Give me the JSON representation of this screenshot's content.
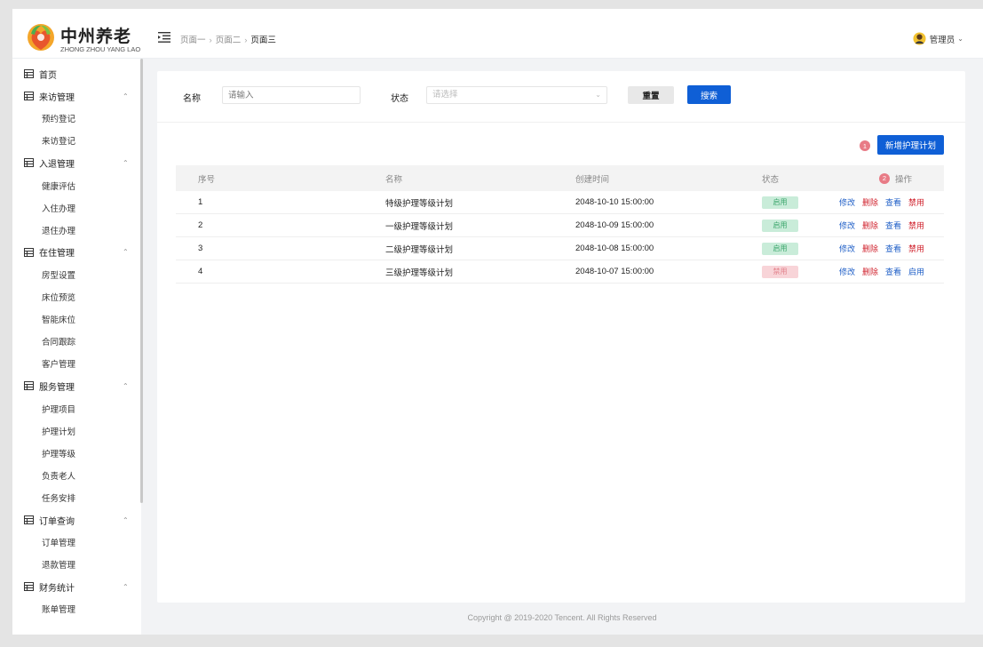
{
  "header": {
    "logo_title": "中州养老",
    "logo_subtitle": "ZHONG ZHOU YANG LAO",
    "breadcrumb": [
      "页面一",
      "页面二",
      "页面三"
    ],
    "user_name": "管理员"
  },
  "sidebar": {
    "items": [
      {
        "label": "首页",
        "type": "group",
        "expandable": false
      },
      {
        "label": "来访管理",
        "type": "group",
        "expandable": true
      },
      {
        "label": "预约登记",
        "type": "child"
      },
      {
        "label": "来访登记",
        "type": "child"
      },
      {
        "label": "入退管理",
        "type": "group",
        "expandable": true
      },
      {
        "label": "健康评估",
        "type": "child"
      },
      {
        "label": "入住办理",
        "type": "child"
      },
      {
        "label": "退住办理",
        "type": "child"
      },
      {
        "label": "在住管理",
        "type": "group",
        "expandable": true
      },
      {
        "label": "房型设置",
        "type": "child"
      },
      {
        "label": "床位预览",
        "type": "child"
      },
      {
        "label": "智能床位",
        "type": "child"
      },
      {
        "label": "合同跟踪",
        "type": "child"
      },
      {
        "label": "客户管理",
        "type": "child"
      },
      {
        "label": "服务管理",
        "type": "group",
        "expandable": true
      },
      {
        "label": "护理项目",
        "type": "child"
      },
      {
        "label": "护理计划",
        "type": "child"
      },
      {
        "label": "护理等级",
        "type": "child"
      },
      {
        "label": "负责老人",
        "type": "child"
      },
      {
        "label": "任务安排",
        "type": "child"
      },
      {
        "label": "订单查询",
        "type": "group",
        "expandable": true
      },
      {
        "label": "订单管理",
        "type": "child"
      },
      {
        "label": "退款管理",
        "type": "child"
      },
      {
        "label": "财务统计",
        "type": "group",
        "expandable": true
      },
      {
        "label": "账单管理",
        "type": "child"
      }
    ]
  },
  "filter": {
    "name_label": "名称",
    "name_placeholder": "请输入",
    "status_label": "状态",
    "status_placeholder": "请选择",
    "reset_label": "重置",
    "search_label": "搜索"
  },
  "actions": {
    "add_label": "新增护理计划",
    "step1": "1",
    "step2": "2"
  },
  "table": {
    "columns": [
      "序号",
      "名称",
      "创建时间",
      "状态",
      "操作"
    ],
    "rows": [
      {
        "index": "1",
        "name": "特级护理等级计划",
        "created": "2048-10-10 15:00:00",
        "status": "启用",
        "status_active": true,
        "ops": [
          "修改",
          "删除",
          "查看",
          "禁用"
        ]
      },
      {
        "index": "2",
        "name": "一级护理等级计划",
        "created": "2048-10-09 15:00:00",
        "status": "启用",
        "status_active": true,
        "ops": [
          "修改",
          "删除",
          "查看",
          "禁用"
        ]
      },
      {
        "index": "3",
        "name": "二级护理等级计划",
        "created": "2048-10-08 15:00:00",
        "status": "启用",
        "status_active": true,
        "ops": [
          "修改",
          "删除",
          "查看",
          "禁用"
        ]
      },
      {
        "index": "4",
        "name": "三级护理等级计划",
        "created": "2048-10-07 15:00:00",
        "status": "禁用",
        "status_active": false,
        "ops": [
          "修改",
          "删除",
          "查看",
          "启用"
        ]
      }
    ]
  },
  "footer": {
    "copyright": "Copyright @ 2019-2020 Tencent. All Rights Reserved"
  },
  "colors": {
    "primary": "#0f5fd6",
    "danger": "#d0232e",
    "success_bg": "#c9ecd9",
    "disabled_bg": "#f8d4d8",
    "badge": "#e87b86"
  }
}
